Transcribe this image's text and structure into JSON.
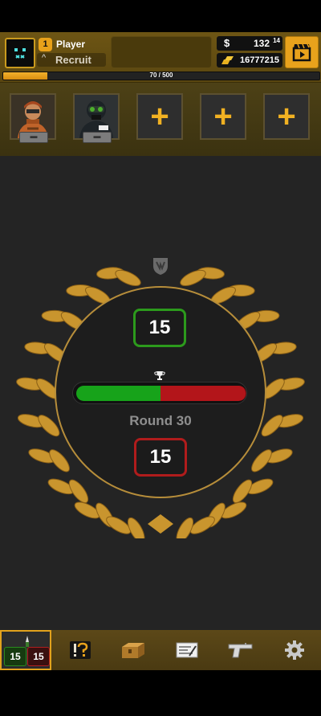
{
  "header": {
    "player_level": "1",
    "player_name": "Player",
    "rank_name": "Recruit",
    "money": "132",
    "money_cents": "14",
    "money_symbol": "$",
    "gold": "16777215",
    "xp_text": "70 / 500",
    "xp_progress": 0.14
  },
  "team": {
    "slots": [
      {
        "type": "operator",
        "icon": "desert-soldier"
      },
      {
        "type": "operator",
        "icon": "swat-soldier"
      },
      {
        "type": "empty",
        "label": "+"
      },
      {
        "type": "empty",
        "label": "+"
      },
      {
        "type": "empty",
        "label": "+"
      }
    ]
  },
  "scoreboard": {
    "ct_score": "15",
    "t_score": "15",
    "round_label": "Round 30",
    "round_segments": [
      "green",
      "green",
      "green",
      "red",
      "red",
      "red"
    ],
    "colors": {
      "ct": "#2c9a1c",
      "t": "#b01c1c",
      "accent": "#e2a21c",
      "laurel": "#c9952e"
    }
  },
  "nav": {
    "active": "match",
    "items": [
      {
        "name": "match",
        "ct": "15",
        "t": "15"
      },
      {
        "name": "missions",
        "icon": "exclamation-question-icon"
      },
      {
        "name": "cases",
        "icon": "crate-icon"
      },
      {
        "name": "market",
        "icon": "ticket-icon"
      },
      {
        "name": "inventory",
        "icon": "pistol-icon"
      },
      {
        "name": "settings",
        "icon": "gear-icon"
      }
    ]
  }
}
